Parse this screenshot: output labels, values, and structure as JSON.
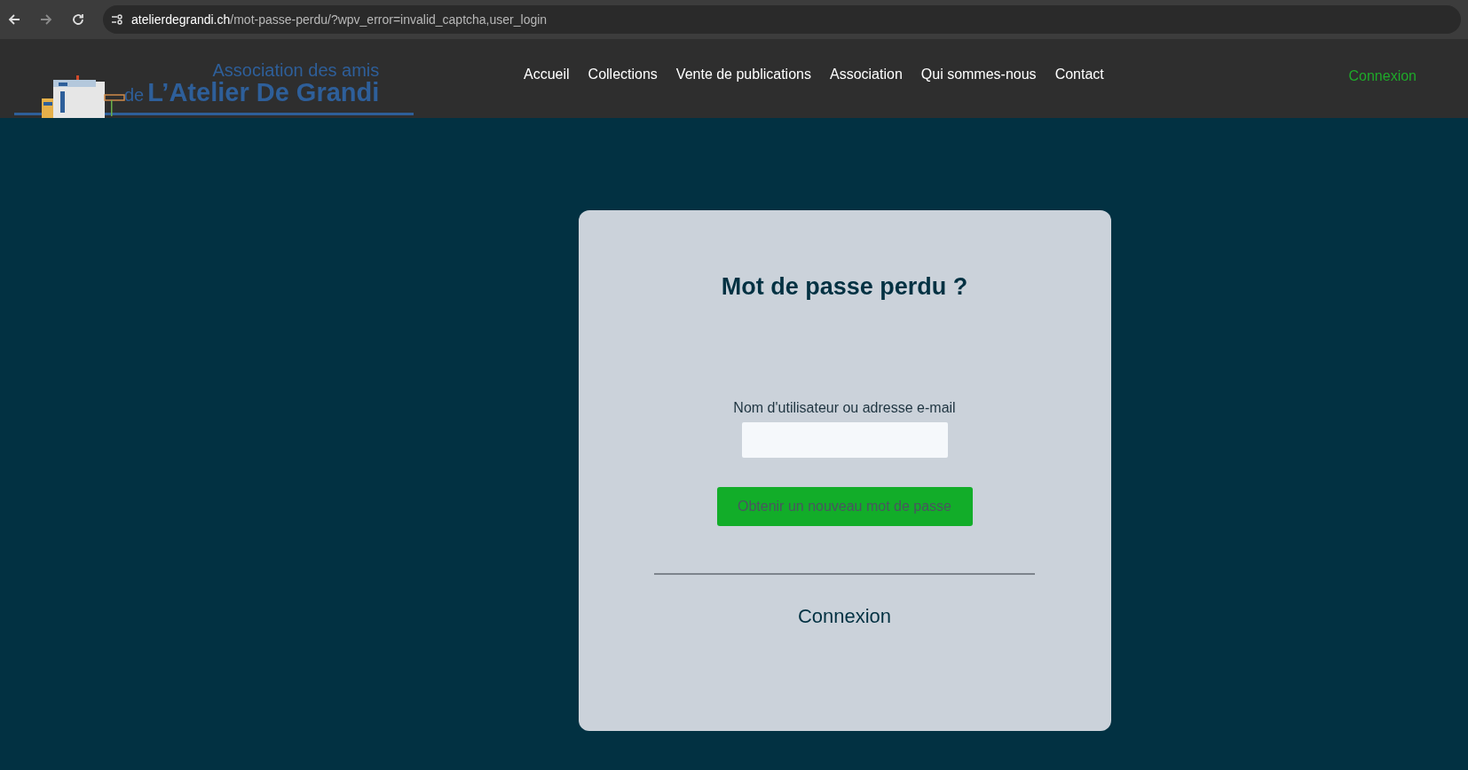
{
  "browser": {
    "url_host": "atelierdegrandi.ch",
    "url_path": "/mot-passe-perdu/?wpv_error=invalid_captcha,user_login"
  },
  "logo": {
    "line_1": "Association des amis",
    "prefix": "de",
    "name": "L’Atelier De Grandi"
  },
  "nav": [
    {
      "label": "Accueil"
    },
    {
      "label": "Collections"
    },
    {
      "label": "Vente de publications"
    },
    {
      "label": "Association"
    },
    {
      "label": "Qui sommes-nous"
    },
    {
      "label": "Contact"
    }
  ],
  "login_link": "Connexion",
  "card": {
    "title": "Mot de passe perdu ?",
    "field_label": "Nom d'utilisateur ou adresse e-mail",
    "submit": "Obtenir un nouveau mot de passe",
    "login": "Connexion"
  }
}
